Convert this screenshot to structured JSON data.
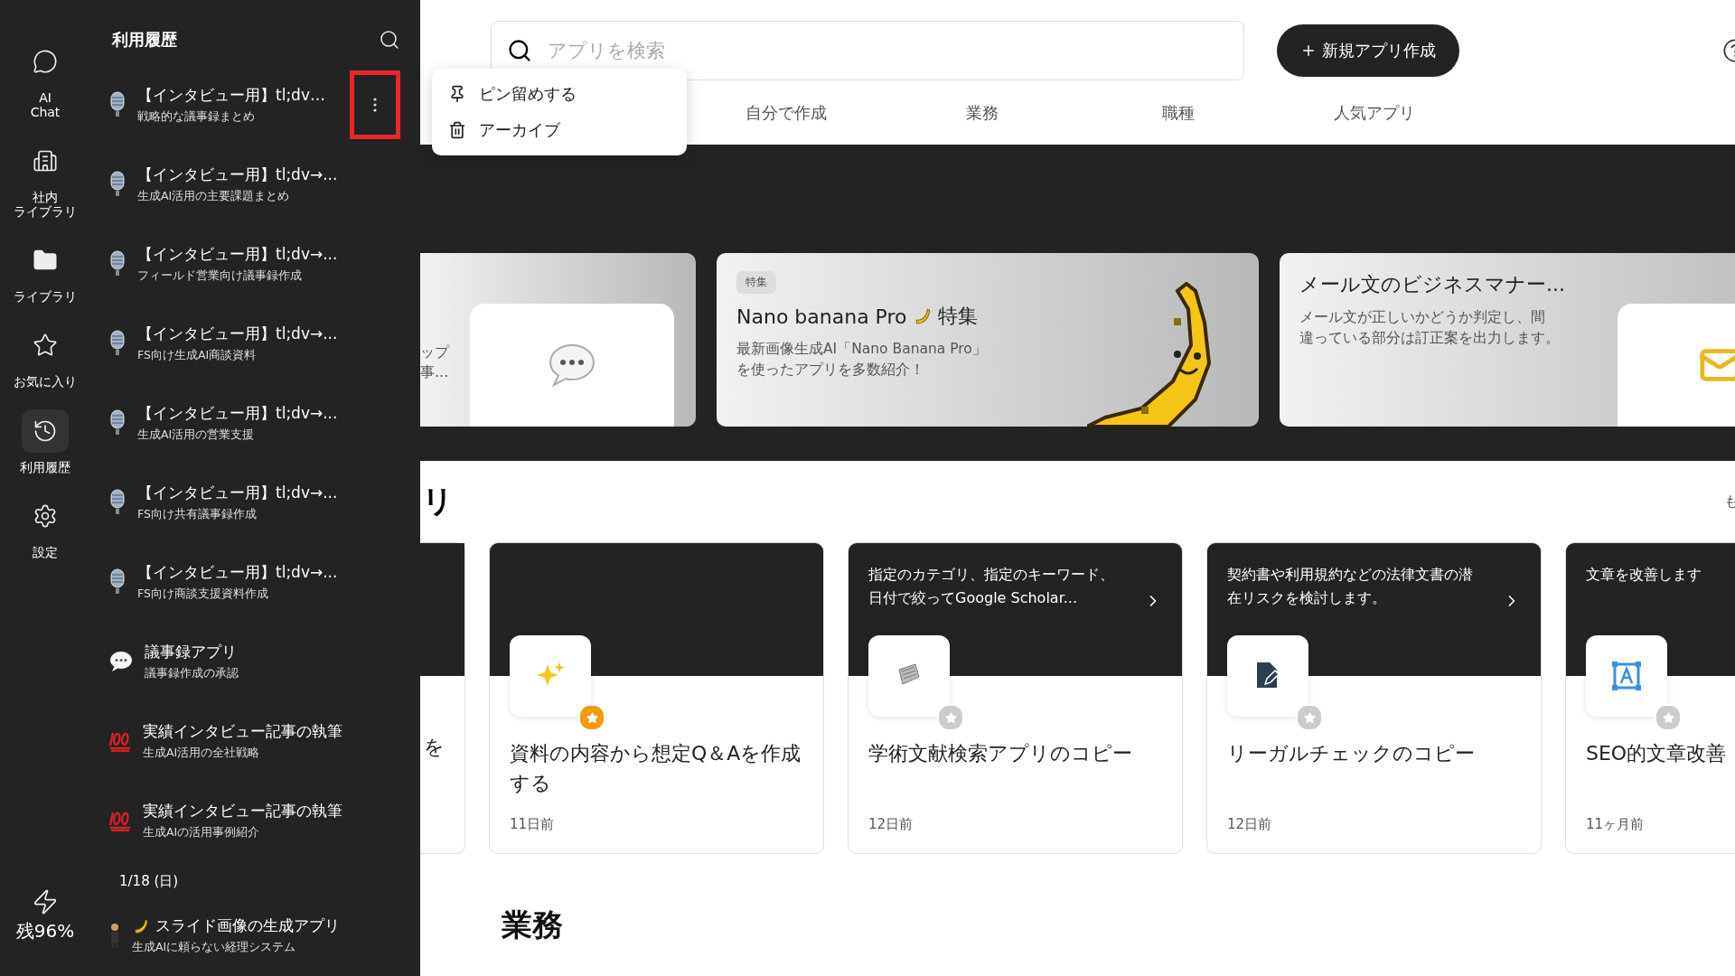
{
  "rail": {
    "items": [
      {
        "lines": [
          "AI",
          "Chat"
        ],
        "kind": "chat",
        "selected": false
      },
      {
        "lines": [
          "社内",
          "ライブラリ"
        ],
        "kind": "building",
        "selected": false
      },
      {
        "lines": [
          "ライブラリ"
        ],
        "kind": "folder",
        "selected": false
      },
      {
        "lines": [
          "お気に入り"
        ],
        "kind": "star",
        "selected": false
      },
      {
        "lines": [
          "利用履歴"
        ],
        "kind": "history",
        "selected": true
      },
      {
        "lines": [
          "設定"
        ],
        "kind": "gear",
        "selected": false
      }
    ],
    "usage": "残96%"
  },
  "history": {
    "title": "利用履歴",
    "groups": [
      {
        "items": [
          {
            "title": "【インタビュー用】tl;dv…",
            "subtitle": "戦略的な議事録まとめ",
            "kind": "mic",
            "menu_open": true
          },
          {
            "title": "【インタビュー用】tl;dv→...",
            "subtitle": "生成AI活用の主要課題まとめ",
            "kind": "mic",
            "menu_open": false
          },
          {
            "title": "【インタビュー用】tl;dv→...",
            "subtitle": "フィールド営業向け議事録作成",
            "kind": "mic",
            "menu_open": false
          },
          {
            "title": "【インタビュー用】tl;dv→...",
            "subtitle": "FS向け生成AI商談資料",
            "kind": "mic",
            "menu_open": false
          },
          {
            "title": "【インタビュー用】tl;dv→...",
            "subtitle": "生成AI活用の営業支援",
            "kind": "mic",
            "menu_open": false
          },
          {
            "title": "【インタビュー用】tl;dv→...",
            "subtitle": "FS向け共有議事録作成",
            "kind": "mic",
            "menu_open": false
          },
          {
            "title": "【インタビュー用】tl;dv→...",
            "subtitle": "FS向け商談支援資料作成",
            "kind": "mic",
            "menu_open": false
          },
          {
            "title": "議事録アプリ",
            "subtitle": "議事録作成の承認",
            "kind": "chat",
            "menu_open": false
          },
          {
            "title": "実績インタビュー記事の執筆",
            "subtitle": "生成AI活用の全社戦略",
            "kind": "hundred",
            "menu_open": false
          },
          {
            "title": "実績インタビュー記事の執筆",
            "subtitle": "生成AIの活用事例紹介",
            "kind": "hundred",
            "menu_open": false
          }
        ]
      },
      {
        "date": "1/18 (日)",
        "items": [
          {
            "title": "スライド画像の生成アプリ",
            "subtitle": "生成AIに頼らない経理システム",
            "kind": "slide",
            "menu_open": false
          }
        ]
      }
    ]
  },
  "context_menu": {
    "items": [
      {
        "label": "ピン留めする",
        "kind": "pin"
      },
      {
        "label": "アーカイブ",
        "kind": "trash"
      }
    ]
  },
  "search": {
    "placeholder": "アプリを検索"
  },
  "new_app_button": "新規アプリ作成",
  "tabs": [
    {
      "label": "自分で作成"
    },
    {
      "label": "業務"
    },
    {
      "label": "職種"
    },
    {
      "label": "人気アプリ"
    }
  ],
  "banners": [
    {
      "kind": "partial",
      "lines": [
        "ップ",
        "事..."
      ]
    },
    {
      "kind": "feature",
      "tag": "特集",
      "title": "Nano banana Pro",
      "title_suffix": "特集",
      "description_lines": [
        "最新画像生成AI「Nano Banana Pro」",
        "を使ったアプリを多数紹介！"
      ]
    },
    {
      "kind": "app",
      "title": "メール文のビジネスマナー...",
      "description_lines": [
        "メール文が正しいかどうか判定し、間",
        "違っている部分は訂正案を出力します。"
      ]
    }
  ],
  "section": {
    "title_fragment": "リ",
    "more_fragment": "も",
    "partial_card_text": "を",
    "cards": [
      {
        "title": "資料の内容から想定Q＆Aを作成する",
        "date": "11日前",
        "kind": "sparkles",
        "favorite": true
      },
      {
        "description": "指定のカテゴリ、指定のキーワード、日付で絞ってGoogle Scholar...",
        "title": "学術文献検索アプリのコピー",
        "date": "12日前",
        "kind": "scroll",
        "favorite": false
      },
      {
        "description": "契約書や利用規約などの法律文書の潜在リスクを検討します。",
        "title": "リーガルチェックのコピー",
        "date": "12日前",
        "kind": "doc",
        "favorite": false
      },
      {
        "description": "文章を改善します",
        "title": "SEO的文章改善",
        "date": "11ヶ月前",
        "kind": "textframe",
        "favorite": false
      }
    ]
  },
  "next_section_title": "業務"
}
